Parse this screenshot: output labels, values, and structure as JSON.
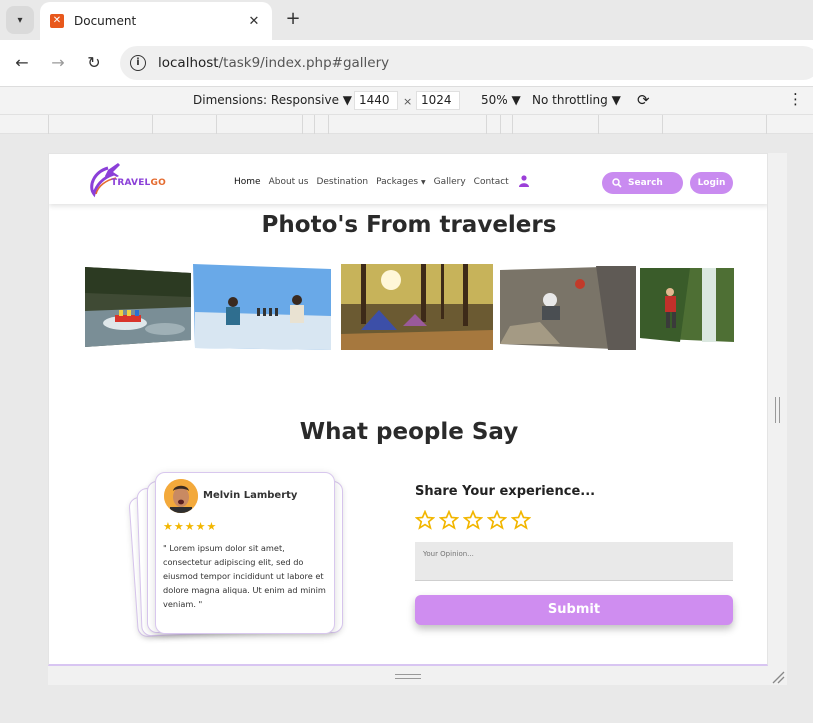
{
  "browser": {
    "tab_title": "Document",
    "url_host": "localhost",
    "url_path": "/task9/index.php#gallery"
  },
  "devtools": {
    "dimensions_label": "Dimensions: Responsive",
    "width": "1440",
    "height": "1024",
    "times": "×",
    "zoom": "50%",
    "throttling": "No throttling"
  },
  "site": {
    "logo_travel": "TRAVEL",
    "logo_go": "GO",
    "nav": [
      "Home",
      "About us",
      "Destination",
      "Packages",
      "Gallery",
      "Contact"
    ],
    "search_label": "Search",
    "login_label": "Login",
    "gallery_title": "Photo's From travelers",
    "testimonials_title": "What people Say",
    "testimonial": {
      "name": "Melvin Lamberty",
      "stars": "★★★★★",
      "quote": "\" Lorem ipsum dolor sit amet, consectetur adipiscing elit, sed do eiusmod tempor incididunt ut labore et dolore magna aliqua. Ut enim ad minim veniam. \""
    },
    "share_title": "Share Your experience...",
    "opinion_placeholder": "Your Opinion...",
    "submit_label": "Submit"
  },
  "colors": {
    "accent": "#c98bf0",
    "logo_purple": "#8b3fd8",
    "logo_orange": "#e46a2e",
    "star": "#f2b600"
  }
}
